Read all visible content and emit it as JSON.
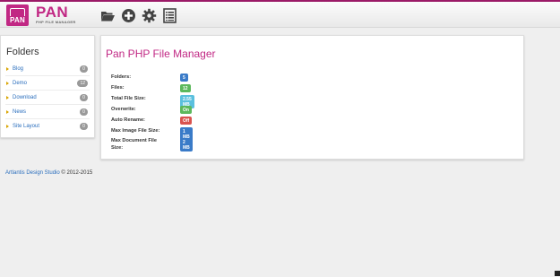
{
  "header": {
    "logo_small": "PAN",
    "logo_big": "PAN",
    "logo_sub": "PHP FILE MANAGER",
    "tools": [
      {
        "icon": "folder-open-icon"
      },
      {
        "icon": "add-circle-icon"
      },
      {
        "icon": "gear-icon"
      },
      {
        "icon": "list-icon"
      }
    ]
  },
  "sidebar": {
    "title": "Folders",
    "items": [
      {
        "label": "Blog",
        "count": "0"
      },
      {
        "label": "Demo",
        "count": "12"
      },
      {
        "label": "Download",
        "count": "0"
      },
      {
        "label": "News",
        "count": "0"
      },
      {
        "label": "Site Layout",
        "count": "0"
      }
    ]
  },
  "main": {
    "title": "Pan PHP File Manager",
    "stats": [
      {
        "key": "Folders:",
        "value": "5",
        "color": "#3a7bc8"
      },
      {
        "key": "Files:",
        "value": "12",
        "color": "#5cb85c"
      },
      {
        "key": "Total File Size:",
        "value": "2.55 MB",
        "color": "#5bc0de"
      },
      {
        "key": "Overwrite:",
        "value": "On",
        "color": "#5cb85c"
      },
      {
        "key": "Auto Rename:",
        "value": "Off",
        "color": "#d9534f"
      },
      {
        "key": "Max Image File Size:",
        "value": "1 MB",
        "color": "#3a7bc8"
      },
      {
        "key": "Max Document File Size:",
        "value": "2 MB",
        "color": "#3a7bc8"
      }
    ]
  },
  "footer": {
    "link": "Artlantis Design Studio",
    "text": " © 2012-2015"
  },
  "colors": {
    "brand": "#c12884",
    "link": "#2a6ebd"
  }
}
